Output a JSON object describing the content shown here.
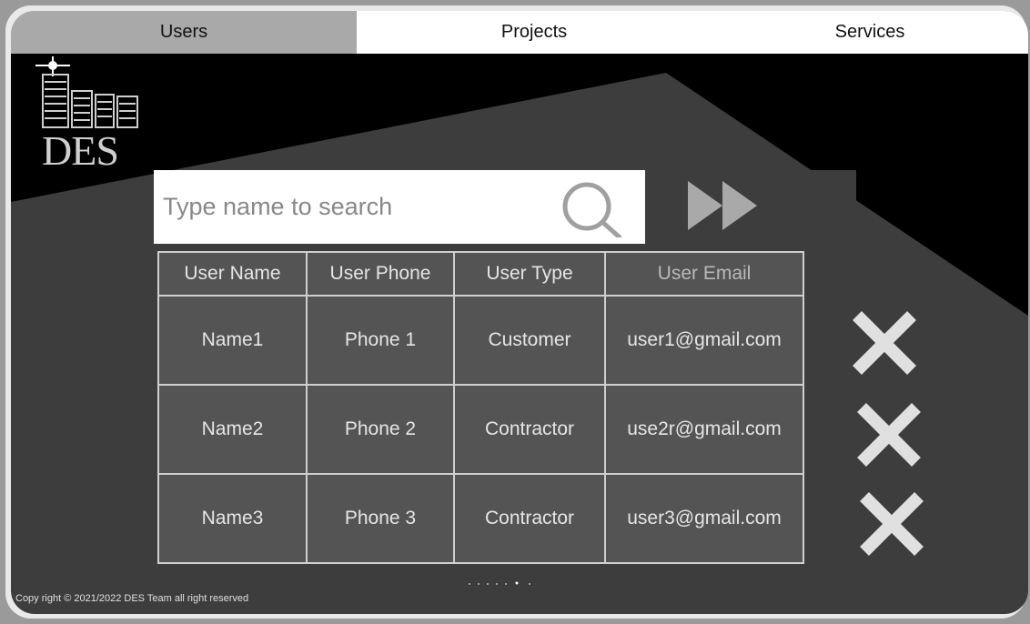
{
  "nav": {
    "tabs": [
      {
        "label": "Users",
        "active": true
      },
      {
        "label": "Projects",
        "active": false
      },
      {
        "label": "Services",
        "active": false
      }
    ]
  },
  "logo": {
    "text": "DES"
  },
  "search": {
    "placeholder": "Type name to search",
    "value": ""
  },
  "table": {
    "headers": [
      "User Name",
      "User Phone",
      "User Type",
      "User Email"
    ],
    "rows": [
      {
        "name": "Name1",
        "phone": "Phone 1",
        "type": "Customer",
        "email": "user1@gmail.com"
      },
      {
        "name": "Name2",
        "phone": "Phone 2",
        "type": "Contractor",
        "email": "use2r@gmail.com"
      },
      {
        "name": "Name3",
        "phone": "Phone 3",
        "type": "Contractor",
        "email": "user3@gmail.com"
      }
    ]
  },
  "footer": {
    "copyright": "Copy right © 2021/2022  DES Team all right reserved"
  },
  "icons": {
    "search": "search-icon",
    "go": "fast-forward-icon",
    "delete": "close-icon",
    "logo": "buildings-logo-icon"
  },
  "colors": {
    "background": "#3d3d3d",
    "dark": "#000000",
    "active_tab": "#a9a9a9",
    "delete": "#e0e0e0"
  }
}
